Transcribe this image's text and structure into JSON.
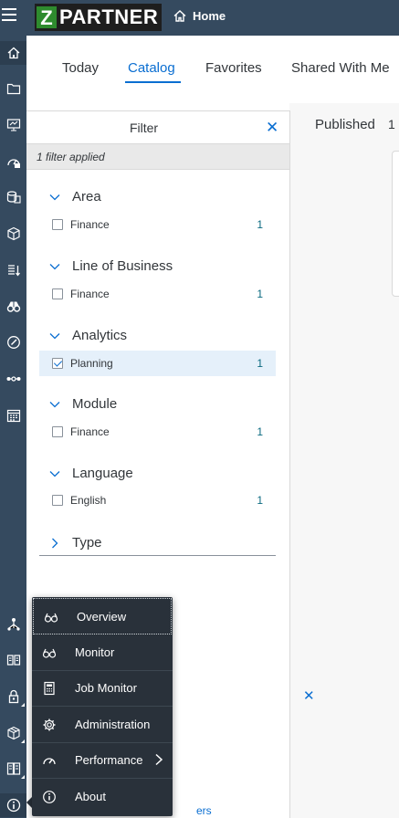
{
  "shell": {
    "logo_letter": "Z",
    "logo_text": "PARTNER",
    "home_label": "Home"
  },
  "tabs": [
    {
      "label": "Today"
    },
    {
      "label": "Catalog"
    },
    {
      "label": "Favorites"
    },
    {
      "label": "Shared With Me"
    }
  ],
  "selected_tab": "Catalog",
  "content": {
    "published_label": "Published",
    "published_sep": "1"
  },
  "filter": {
    "title": "Filter",
    "applied_text": "1 filter applied",
    "groups": [
      {
        "label": "Area",
        "expanded": true,
        "options": [
          {
            "label": "Finance",
            "count": "1",
            "checked": false
          }
        ]
      },
      {
        "label": "Line of Business",
        "expanded": true,
        "options": [
          {
            "label": "Finance",
            "count": "1",
            "checked": false
          }
        ]
      },
      {
        "label": "Analytics",
        "expanded": true,
        "options": [
          {
            "label": "Planning",
            "count": "1",
            "checked": true
          }
        ]
      },
      {
        "label": "Module",
        "expanded": true,
        "options": [
          {
            "label": "Finance",
            "count": "1",
            "checked": false
          }
        ]
      },
      {
        "label": "Language",
        "expanded": true,
        "options": [
          {
            "label": "English",
            "count": "1",
            "checked": false
          }
        ]
      },
      {
        "label": "Type",
        "expanded": false,
        "options": []
      }
    ],
    "bottom_link_partial": "ers"
  },
  "menu": {
    "items": [
      {
        "label": "Overview",
        "icon": "glasses-icon"
      },
      {
        "label": "Monitor",
        "icon": "glasses-icon"
      },
      {
        "label": "Job Monitor",
        "icon": "calculator-icon"
      },
      {
        "label": "Administration",
        "icon": "gear-icon"
      },
      {
        "label": "Performance",
        "icon": "gauge-icon",
        "has_submenu": true
      },
      {
        "label": "About",
        "icon": "info-icon"
      }
    ]
  },
  "colors": {
    "shell": "#354a5f",
    "accent": "#0a6ed1",
    "menu_bg": "#29313a",
    "logo_green": "#2e8b2e"
  }
}
